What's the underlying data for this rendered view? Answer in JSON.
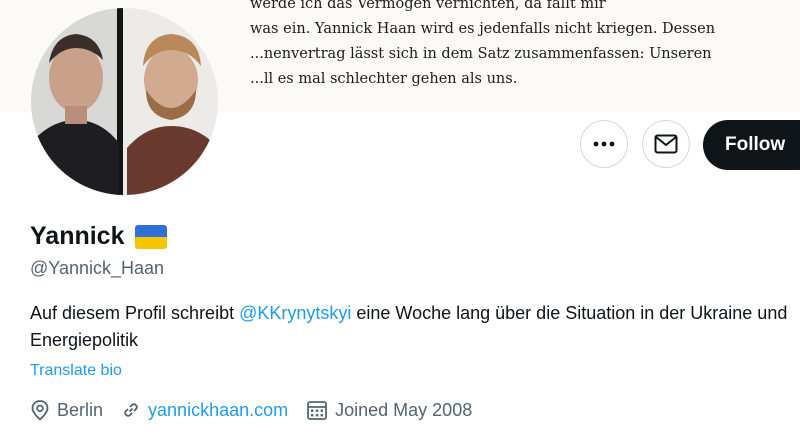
{
  "banner": {
    "lines": [
      "werde ich das Vermögen vernichten, da fällt mir",
      "was ein. Yannick Haan wird es jedenfalls nicht kriegen. Dessen",
      "...nenvertrag lässt sich in dem Satz zusammenfassen: Unseren",
      "...ll es mal schlechter gehen als uns."
    ]
  },
  "actions": {
    "more_icon": "more-horizontal-icon",
    "message_icon": "envelope-icon",
    "follow_label": "Follow"
  },
  "profile": {
    "name": "Yannick",
    "flag": "ukraine-flag",
    "handle": "@Yannick_Haan",
    "bio_before": "Auf diesem Profil schreibt ",
    "bio_mention": "@KKrynytskyi",
    "bio_after": " eine Woche lang über die Situation in der Ukraine und Energiepolitik",
    "translate_label": "Translate bio"
  },
  "meta": {
    "location": "Berlin",
    "website": "yannickhaan.com",
    "joined": "Joined May 2008"
  },
  "colors": {
    "accent": "#1d9bf0",
    "secondary_text": "#536471",
    "follow_bg": "#0f1419"
  }
}
